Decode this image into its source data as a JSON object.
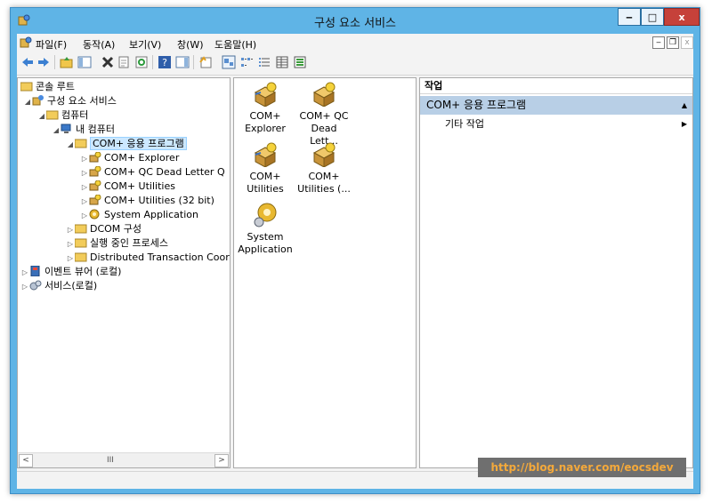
{
  "window": {
    "title": "구성 요소 서비스",
    "controls": {
      "minimize": "‒",
      "maximize": "□",
      "close": "x"
    }
  },
  "menubar": {
    "items": [
      "파일(F)",
      "동작(A)",
      "보기(V)",
      "창(W)",
      "도움말(H)"
    ],
    "mdi_controls": {
      "minimize": "‒",
      "restore": "❐",
      "close": "x"
    }
  },
  "toolbar": {
    "buttons": [
      "back-arrow",
      "forward-arrow",
      "up-folder",
      "show-tree",
      "delete",
      "properties",
      "refresh",
      "help",
      "show-action-pane",
      "new-window",
      "large-icons",
      "small-icons",
      "list",
      "details",
      "status-view"
    ]
  },
  "tree": {
    "rows": [
      {
        "label": "콘솔 루트",
        "expander": "",
        "icon": "console-root-icon"
      },
      {
        "label": "구성 요소 서비스",
        "expander": "◢",
        "icon": "component-services-icon"
      },
      {
        "label": "컴퓨터",
        "expander": "◢",
        "icon": "folder-icon"
      },
      {
        "label": "내 컴퓨터",
        "expander": "◢",
        "icon": "computer-icon"
      },
      {
        "label": "COM+ 응용 프로그램",
        "expander": "◢",
        "icon": "folder-icon"
      },
      {
        "label": "COM+ Explorer",
        "expander": "▷",
        "icon": "com-app-icon"
      },
      {
        "label": "COM+ QC Dead Letter Q",
        "expander": "▷",
        "icon": "com-app-icon"
      },
      {
        "label": "COM+ Utilities",
        "expander": "▷",
        "icon": "com-app-icon"
      },
      {
        "label": "COM+ Utilities (32 bit)",
        "expander": "▷",
        "icon": "com-app-icon"
      },
      {
        "label": "System Application",
        "expander": "▷",
        "icon": "system-app-icon"
      },
      {
        "label": "DCOM 구성",
        "expander": "▷",
        "icon": "folder-icon"
      },
      {
        "label": "실행 중인 프로세스",
        "expander": "▷",
        "icon": "folder-icon"
      },
      {
        "label": "Distributed Transaction Coor",
        "expander": "▷",
        "icon": "folder-icon"
      },
      {
        "label": "이벤트 뷰어 (로컬)",
        "expander": "▷",
        "icon": "event-viewer-icon"
      },
      {
        "label": "서비스(로컬)",
        "expander": "▷",
        "icon": "services-icon"
      }
    ],
    "scrollbar": {
      "left": "<",
      "right": ">",
      "thumb": "III"
    }
  },
  "content": {
    "items": [
      {
        "line1": "COM+",
        "line2": "Explorer",
        "icon": "com-app-icon"
      },
      {
        "line1": "COM+ QC",
        "line2": "Dead Lett...",
        "icon": "com-app-icon"
      },
      {
        "line1": "COM+",
        "line2": "Utilities",
        "icon": "com-app-icon"
      },
      {
        "line1": "COM+",
        "line2": "Utilities (...",
        "icon": "com-app-icon"
      },
      {
        "line1": "System",
        "line2": "Application",
        "icon": "system-app-icon"
      }
    ]
  },
  "actions": {
    "header": "작업",
    "group": {
      "label": "COM+ 응용 프로그램",
      "caret": "▲"
    },
    "items": [
      {
        "label": "기타 작업",
        "caret": "▶"
      }
    ]
  },
  "watermark": "http://blog.naver.com/eocsdev",
  "colors": {
    "titlebar": "#5fb4e6",
    "close_button": "#c6413a",
    "action_group": "#b8cfe6",
    "selection": "#cce8ff"
  }
}
